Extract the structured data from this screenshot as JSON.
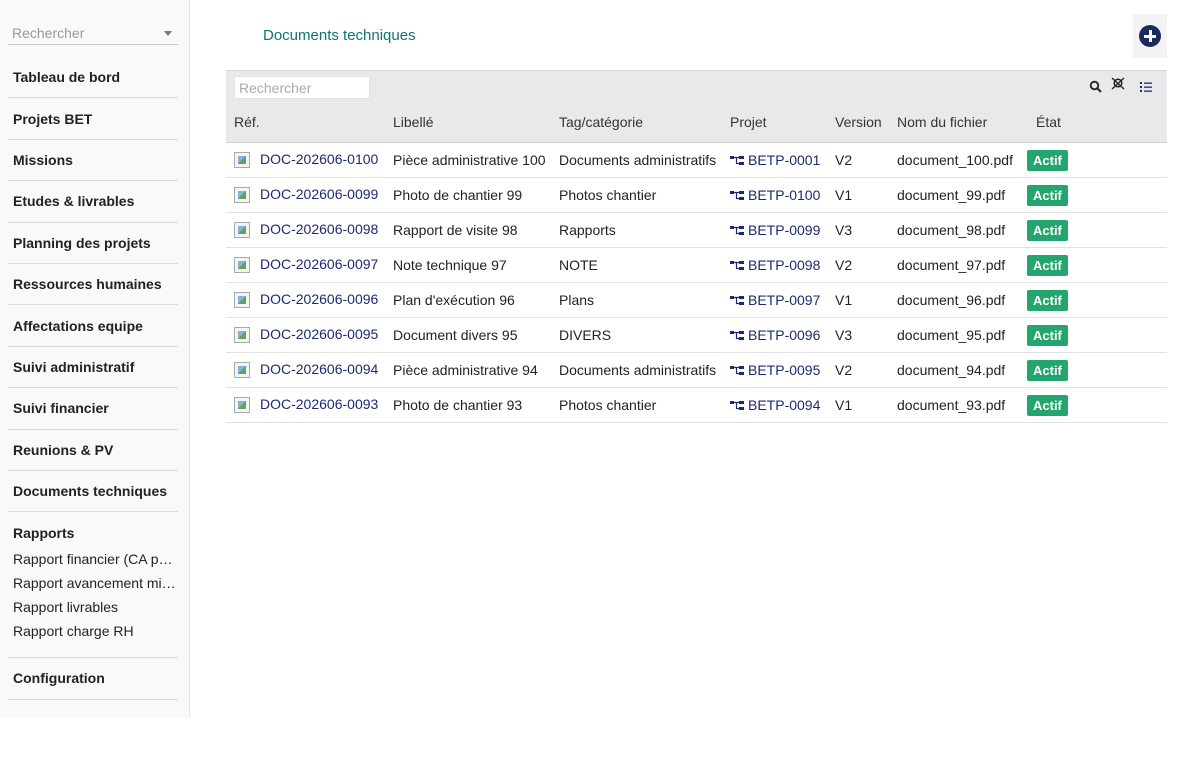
{
  "sidebar": {
    "search_placeholder": "Rechercher",
    "items": [
      {
        "label": "Tableau de bord"
      },
      {
        "label": "Projets BET"
      },
      {
        "label": "Missions"
      },
      {
        "label": "Etudes & livrables"
      },
      {
        "label": "Planning des projets"
      },
      {
        "label": "Ressources humaines"
      },
      {
        "label": "Affectations equipe"
      },
      {
        "label": "Suivi administratif"
      },
      {
        "label": "Suivi financier"
      },
      {
        "label": "Reunions & PV"
      },
      {
        "label": "Documents techniques"
      }
    ],
    "reports": {
      "title": "Rapports",
      "items": [
        {
          "label": "Rapport financier (CA par..."
        },
        {
          "label": "Rapport avancement miss..."
        },
        {
          "label": "Rapport livrables"
        },
        {
          "label": "Rapport charge RH"
        }
      ]
    },
    "config_label": "Configuration"
  },
  "main": {
    "title": "Documents techniques",
    "add_icon": "plus-circle-icon"
  },
  "table": {
    "search_placeholder": "Rechercher",
    "toolbar_icons": [
      "search-icon",
      "clear-filter-icon",
      "list-view-icon"
    ],
    "headers": {
      "ref": "Réf.",
      "libelle": "Libellé",
      "tag": "Tag/catégorie",
      "projet": "Projet",
      "version": "Version",
      "fichier": "Nom du fichier",
      "etat": "État"
    },
    "rows": [
      {
        "ref": "DOC-202606-0100",
        "libelle": "Pièce administrative 100",
        "tag": "Documents administratifs",
        "projet": "BETP-0001",
        "version": "V2",
        "fichier": "document_100.pdf",
        "etat": "Actif"
      },
      {
        "ref": "DOC-202606-0099",
        "libelle": "Photo de chantier 99",
        "tag": "Photos chantier",
        "projet": "BETP-0100",
        "version": "V1",
        "fichier": "document_99.pdf",
        "etat": "Actif"
      },
      {
        "ref": "DOC-202606-0098",
        "libelle": "Rapport de visite 98",
        "tag": "Rapports",
        "projet": "BETP-0099",
        "version": "V3",
        "fichier": "document_98.pdf",
        "etat": "Actif"
      },
      {
        "ref": "DOC-202606-0097",
        "libelle": "Note technique 97",
        "tag": "NOTE",
        "projet": "BETP-0098",
        "version": "V2",
        "fichier": "document_97.pdf",
        "etat": "Actif"
      },
      {
        "ref": "DOC-202606-0096",
        "libelle": "Plan d'exécution 96",
        "tag": "Plans",
        "projet": "BETP-0097",
        "version": "V1",
        "fichier": "document_96.pdf",
        "etat": "Actif"
      },
      {
        "ref": "DOC-202606-0095",
        "libelle": "Document divers 95",
        "tag": "DIVERS",
        "projet": "BETP-0096",
        "version": "V3",
        "fichier": "document_95.pdf",
        "etat": "Actif"
      },
      {
        "ref": "DOC-202606-0094",
        "libelle": "Pièce administrative 94",
        "tag": "Documents administratifs",
        "projet": "BETP-0095",
        "version": "V2",
        "fichier": "document_94.pdf",
        "etat": "Actif"
      },
      {
        "ref": "DOC-202606-0093",
        "libelle": "Photo de chantier 93",
        "tag": "Photos chantier",
        "projet": "BETP-0094",
        "version": "V1",
        "fichier": "document_93.pdf",
        "etat": "Actif"
      }
    ]
  },
  "colors": {
    "title": "#0f7474",
    "link": "#1d2a6e",
    "badge": "#25a56e",
    "add_button": "#1a2a5c"
  }
}
